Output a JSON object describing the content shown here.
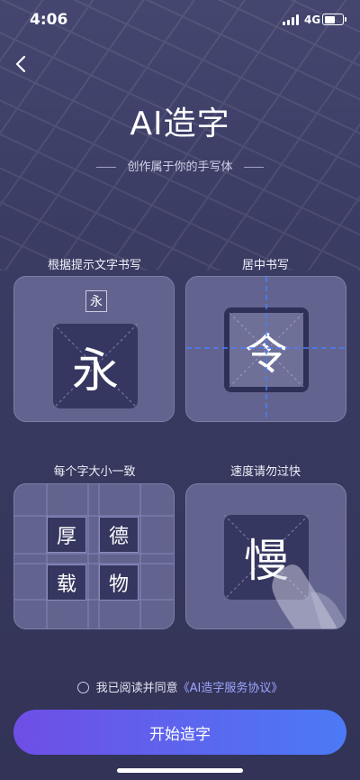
{
  "status_bar": {
    "time": "4:06",
    "network": "4G"
  },
  "header": {
    "title": "AI造字",
    "subtitle": "创作属于你的手写体"
  },
  "cards": {
    "tip1": {
      "label": "根据提示文字书写",
      "hint_char": "永",
      "char": "永"
    },
    "tip2": {
      "label": "居中书写",
      "char": "令"
    },
    "tip3": {
      "label": "每个字大小一致",
      "chars": [
        "厚",
        "德",
        "载",
        "物"
      ]
    },
    "tip4": {
      "label": "速度请勿过快",
      "char": "慢"
    }
  },
  "agreement": {
    "prefix": "我已阅读并同意",
    "link": "《AI造字服务协议》"
  },
  "start_button": {
    "label": "开始造字"
  },
  "colors": {
    "accent_start": "#6f4ee6",
    "accent_end": "#4b7af5",
    "link": "#9fa6ff"
  }
}
